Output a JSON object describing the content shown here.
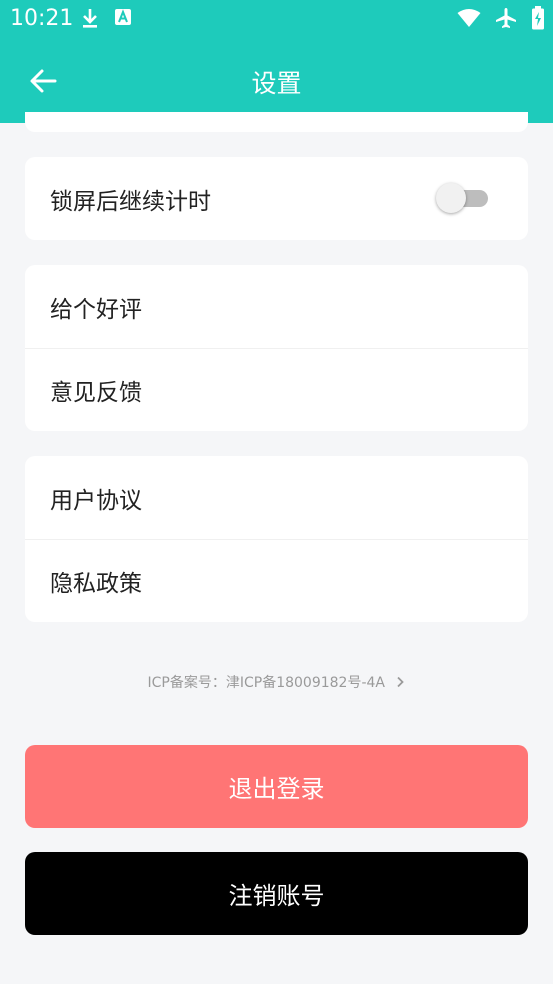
{
  "status_bar": {
    "time": "10:21",
    "left_icons": [
      "download-icon",
      "a-badge-icon"
    ],
    "right_icons": [
      "wifi-icon",
      "airplane-icon",
      "battery-charging-icon"
    ]
  },
  "app_bar": {
    "title": "设置",
    "back_icon": "arrow-left-icon"
  },
  "settings": {
    "lock_screen_label": "锁屏后继续计时",
    "lock_screen_enabled": false,
    "rate_label": "给个好评",
    "feedback_label": "意见反馈",
    "agreement_label": "用户协议",
    "privacy_label": "隐私政策"
  },
  "icp_text": "ICP备案号：津ICP备18009182号-4A",
  "logout_label": "退出登录",
  "delete_account_label": "注销账号",
  "colors": {
    "header": "#1ecbbb",
    "logout_button": "#ff7575",
    "delete_button": "#000000",
    "background": "#f5f6f8"
  }
}
